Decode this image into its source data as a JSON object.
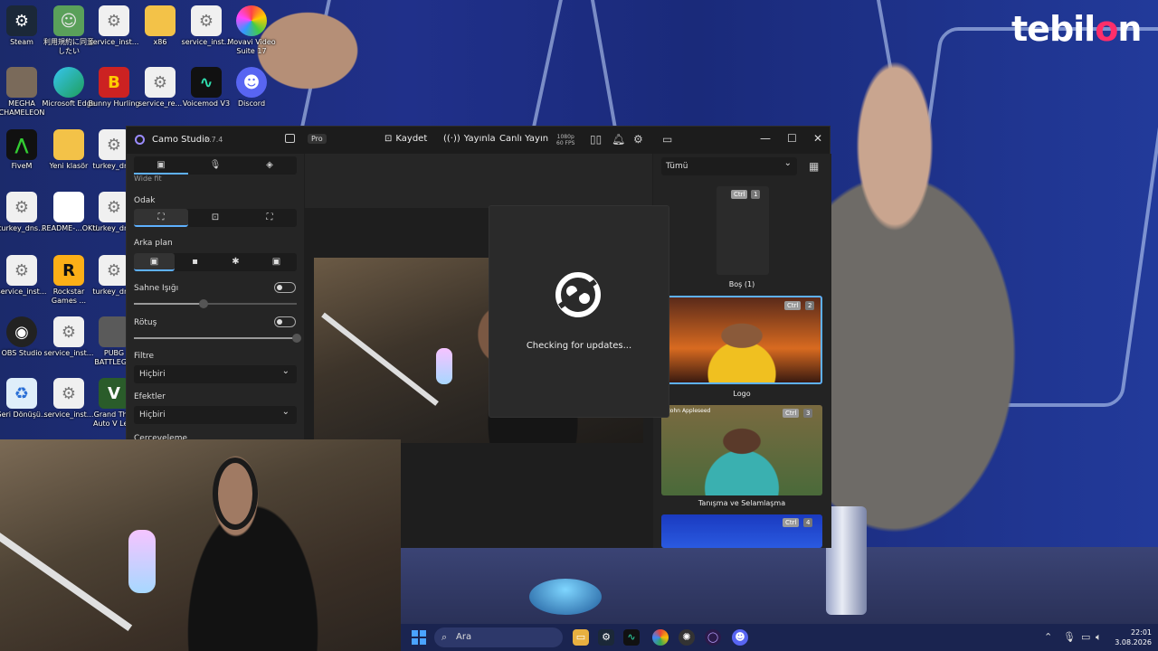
{
  "brand": {
    "prefix": "tebil",
    "accent": "o",
    "suffix": "n"
  },
  "desktop_icons": [
    {
      "label": "Steam"
    },
    {
      "label": "利用規約に同意したい"
    },
    {
      "label": "service_inst..."
    },
    {
      "label": "x86"
    },
    {
      "label": "service_inst..."
    },
    {
      "label": "Movavi Video Suite 17"
    },
    {
      "label": "MEGHA CHAMELEON"
    },
    {
      "label": "Microsoft Edge"
    },
    {
      "label": "Bunny Hurling"
    },
    {
      "label": "service_re..."
    },
    {
      "label": "Voicemod V3"
    },
    {
      "label": "Discord"
    },
    {
      "label": "FiveM"
    },
    {
      "label": "Yeni klasör"
    },
    {
      "label": "turkey_dn..."
    },
    {
      "label": "turkey_dns..."
    },
    {
      "label": "README-...OKU"
    },
    {
      "label": "turkey_dn..."
    },
    {
      "label": "service_inst..."
    },
    {
      "label": "Rockstar Games ..."
    },
    {
      "label": "turkey_dn..."
    },
    {
      "label": "OBS Studio"
    },
    {
      "label": "service_inst..."
    },
    {
      "label": "PUBG BATTLEG..."
    },
    {
      "label": "Geri Dönüşü..."
    },
    {
      "label": "service_inst..."
    },
    {
      "label": "Grand Th... Auto V Le..."
    }
  ],
  "camo": {
    "title": "Camo Studio",
    "version": "2.7.4",
    "pro_label": "Pro",
    "record_label": "Kaydet",
    "stream_label": "Yayınla",
    "live_label": "Canlı Yayın",
    "res_top": "1080p",
    "res_bottom": "60 FPS",
    "left": {
      "partial_label": "Wide fit",
      "focus_label": "Odak",
      "background_label": "Arka plan",
      "stage_light_label": "Sahne Işığı",
      "stage_light_level": 0.43,
      "retouch_label": "Rötuş",
      "retouch_level": 1.0,
      "filter_label": "Filtre",
      "filter_value": "Hiçbiri",
      "effects_label": "Efektler",
      "effects_value": "Hiçbiri",
      "framing_label": "Çerçeveleme"
    },
    "right": {
      "filter_value": "Tümü",
      "scenes": [
        {
          "ctrl": "Ctrl",
          "num": "1",
          "caption": "Boş (1)"
        },
        {
          "ctrl": "Ctrl",
          "num": "2",
          "caption": "Logo"
        },
        {
          "ctrl": "Ctrl",
          "num": "3",
          "caption": "Tanışma ve Selamlaşma",
          "overlay": "John Appleseed"
        },
        {
          "ctrl": "Ctrl",
          "num": "4",
          "caption": ""
        }
      ]
    },
    "dialog_message": "Checking for updates..."
  },
  "taskbar": {
    "search_placeholder": "Ara",
    "time": "22:01",
    "date": "3.08.2026"
  }
}
